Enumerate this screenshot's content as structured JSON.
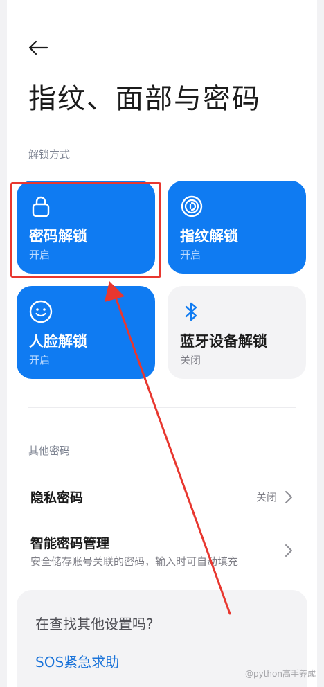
{
  "header": {
    "title": "指纹、面部与密码"
  },
  "sections": {
    "unlock": "解锁方式",
    "other": "其他密码"
  },
  "unlock_methods": [
    {
      "name": "密码解锁",
      "status": "开启",
      "enabled": true,
      "icon": "lock-icon"
    },
    {
      "name": "指纹解锁",
      "status": "开启",
      "enabled": true,
      "icon": "fingerprint-icon"
    },
    {
      "name": "人脸解锁",
      "status": "开启",
      "enabled": true,
      "icon": "face-icon"
    },
    {
      "name": "蓝牙设备解锁",
      "status": "关闭",
      "enabled": false,
      "icon": "bluetooth-icon"
    }
  ],
  "other_items": [
    {
      "title": "隐私密码",
      "value": "关闭"
    },
    {
      "title": "智能密码管理",
      "subtitle": "安全储存账号关联的密码，输入时可自动填充"
    }
  ],
  "search_card": {
    "question": "在查找其他设置吗?",
    "link": "SOS紧急求助"
  },
  "watermark": "@python高手养成",
  "colors": {
    "accent": "#0f7bf2",
    "annotation": "#e8372f"
  }
}
